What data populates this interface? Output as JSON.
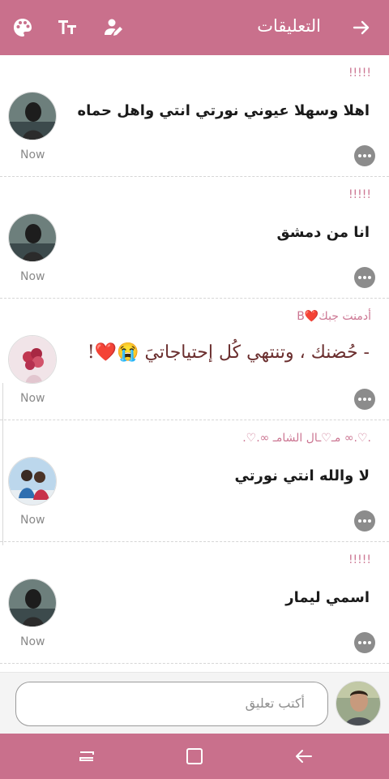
{
  "header": {
    "title": "التعليقات",
    "icons": [
      "palette-icon",
      "text-size-icon",
      "edit-user-icon",
      "arrow-back-icon"
    ]
  },
  "comments": [
    {
      "username": "!!!!!",
      "text": "اهلا وسهلا عيوني نورتي انتي واهل حماه",
      "time": "Now",
      "avatar": "avatar-dark"
    },
    {
      "username": "!!!!!",
      "text": "انا من دمشق",
      "time": "Now",
      "avatar": "avatar-dark"
    },
    {
      "username": "أدمنت جبك❤️B",
      "text": "- حُضنك ، وتنتهي كُل إحتياجاتيَ 😭❤️!",
      "time": "Now",
      "avatar": "avatar-flowers"
    },
    {
      "username": ".♡.∞ مـ♡ـال الشامـ ∞.♡.",
      "text": "لا والله انتي نورتي",
      "time": "Now",
      "avatar": "avatar-couple"
    },
    {
      "username": "!!!!!",
      "text": "اسمي ليمار",
      "time": "Now",
      "avatar": "avatar-dark"
    }
  ],
  "composer": {
    "placeholder": "أكتب تعليق"
  },
  "colors": {
    "accent": "#c9708c",
    "username": "#cc7793"
  }
}
